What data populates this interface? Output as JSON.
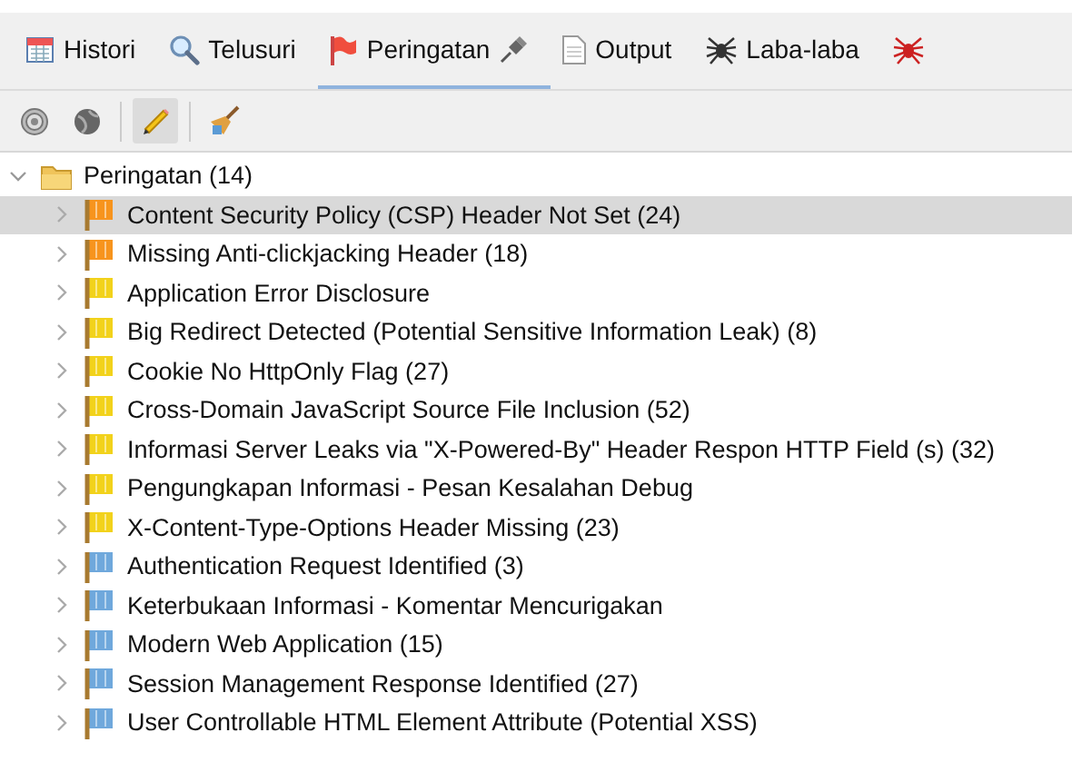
{
  "tabs": [
    {
      "label": "Histori",
      "selected": false
    },
    {
      "label": "Telusuri",
      "selected": false
    },
    {
      "label": "Peringatan",
      "selected": true,
      "pinned": true
    },
    {
      "label": "Output",
      "selected": false
    },
    {
      "label": "Laba-laba",
      "selected": false
    },
    {
      "selected": false
    }
  ],
  "toolbar": [
    {
      "selected": false
    },
    {
      "selected": false
    },
    {
      "selected": true
    },
    {
      "selected": false
    }
  ],
  "tree": {
    "label": "Peringatan (14)",
    "expanded": true,
    "children": [
      {
        "label": "Content Security Policy (CSP) Header Not Set (24)",
        "color": "#f7941d",
        "selected": true
      },
      {
        "label": "Missing Anti-clickjacking Header (18)",
        "color": "#f7941d",
        "selected": false
      },
      {
        "label": "Application Error Disclosure",
        "color": "#f2d21b",
        "selected": false
      },
      {
        "label": "Big Redirect Detected (Potential Sensitive Information Leak) (8)",
        "color": "#f2d21b",
        "selected": false
      },
      {
        "label": "Cookie No HttpOnly Flag (27)",
        "color": "#f2d21b",
        "selected": false
      },
      {
        "label": "Cross-Domain JavaScript Source File Inclusion (52)",
        "color": "#f2d21b",
        "selected": false
      },
      {
        "label": "Informasi Server Leaks via \"X-Powered-By\" Header Respon HTTP Field (s) (32)",
        "color": "#f2d21b",
        "selected": false
      },
      {
        "label": "Pengungkapan Informasi - Pesan Kesalahan Debug",
        "color": "#f2d21b",
        "selected": false
      },
      {
        "label": "X-Content-Type-Options Header Missing (23)",
        "color": "#f2d21b",
        "selected": false
      },
      {
        "label": "Authentication Request Identified (3)",
        "color": "#6fa8dc",
        "selected": false
      },
      {
        "label": "Keterbukaan Informasi - Komentar Mencurigakan",
        "color": "#6fa8dc",
        "selected": false
      },
      {
        "label": "Modern Web Application (15)",
        "color": "#6fa8dc",
        "selected": false
      },
      {
        "label": "Session Management Response Identified (27)",
        "color": "#6fa8dc",
        "selected": false
      },
      {
        "label": "User Controllable HTML Element Attribute (Potential XSS)",
        "color": "#6fa8dc",
        "selected": false
      }
    ]
  }
}
